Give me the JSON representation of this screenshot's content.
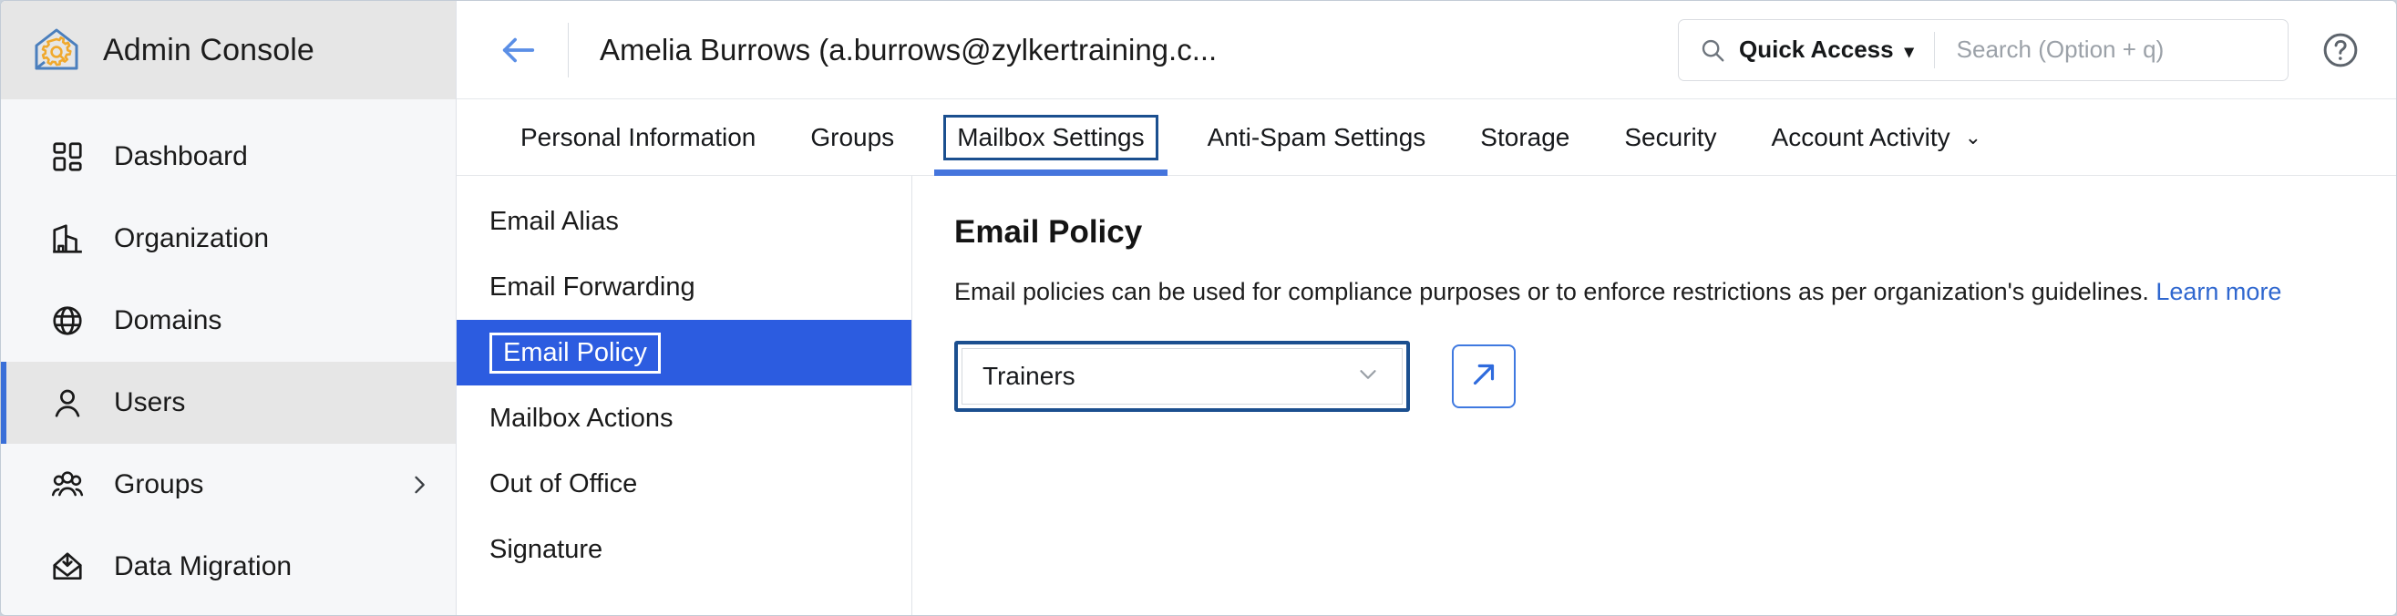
{
  "brand": {
    "title": "Admin Console",
    "logo_icon": "home-gear-icon"
  },
  "sidebar": {
    "items": [
      {
        "label": "Dashboard",
        "icon": "grid-icon",
        "selected": false,
        "has_chevron": false
      },
      {
        "label": "Organization",
        "icon": "building-icon",
        "selected": false,
        "has_chevron": false
      },
      {
        "label": "Domains",
        "icon": "globe-icon",
        "selected": false,
        "has_chevron": false
      },
      {
        "label": "Users",
        "icon": "user-icon",
        "selected": true,
        "has_chevron": false
      },
      {
        "label": "Groups",
        "icon": "users-icon",
        "selected": false,
        "has_chevron": true
      },
      {
        "label": "Data Migration",
        "icon": "inbox-download-icon",
        "selected": false,
        "has_chevron": false
      }
    ]
  },
  "topbar": {
    "back_icon": "arrow-left-icon",
    "title": "Amelia Burrows (a.burrows@zylkertraining.c...",
    "search": {
      "icon": "search-icon",
      "quick_access_label": "Quick Access",
      "caret": "▾",
      "placeholder": "Search (Option + q)",
      "value": ""
    },
    "help_icon": "help-circle-icon"
  },
  "tabs": [
    {
      "label": "Personal Information",
      "active": false,
      "focused": false,
      "caret": ""
    },
    {
      "label": "Groups",
      "active": false,
      "focused": false,
      "caret": ""
    },
    {
      "label": "Mailbox Settings",
      "active": true,
      "focused": true,
      "caret": ""
    },
    {
      "label": "Anti-Spam Settings",
      "active": false,
      "focused": false,
      "caret": ""
    },
    {
      "label": "Storage",
      "active": false,
      "focused": false,
      "caret": ""
    },
    {
      "label": "Security",
      "active": false,
      "focused": false,
      "caret": ""
    },
    {
      "label": "Account Activity",
      "active": false,
      "focused": false,
      "caret": "⌄"
    }
  ],
  "submenu": {
    "items": [
      {
        "label": "Email Alias",
        "selected": false
      },
      {
        "label": "Email Forwarding",
        "selected": false
      },
      {
        "label": "Email Policy",
        "selected": true
      },
      {
        "label": "Mailbox Actions",
        "selected": false
      },
      {
        "label": "Out of Office",
        "selected": false
      },
      {
        "label": "Signature",
        "selected": false
      }
    ]
  },
  "panel": {
    "title": "Email Policy",
    "description": "Email policies can be used for compliance purposes or to enforce restrictions as per organization's guidelines.",
    "learn_more": "Learn more",
    "policy_select": {
      "value": "Trainers",
      "chevron_icon": "chevron-down-icon",
      "options": [
        "Trainers"
      ]
    },
    "open_external_icon": "arrow-up-right-icon"
  },
  "colors": {
    "accent_blue": "#2c5ce0",
    "focus_navy": "#1b4f8f",
    "link_blue": "#2f67cf",
    "tab_underline": "#4575dd",
    "sidebar_bg": "#f6f7f9",
    "brand_bg": "#e6e6e6",
    "logo_outline": "#4b7fbd",
    "logo_gear": "#f0a92e"
  }
}
